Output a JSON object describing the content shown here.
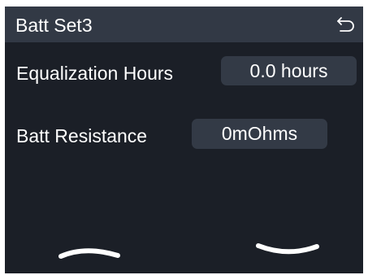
{
  "title_bar": {
    "title": "Batt Set3",
    "back_icon": "return-arrow-icon"
  },
  "settings": [
    {
      "label": "Equalization Hours",
      "value": "0.0 hours"
    },
    {
      "label": "Batt Resistance",
      "value": "0mOhms"
    }
  ],
  "navigation": {
    "up_icon": "chevron-up-icon",
    "down_icon": "chevron-down-icon"
  },
  "colors": {
    "screen_background": "#1b1f27",
    "title_bar_background": "#323945",
    "value_box_background": "#333a46",
    "text": "#ffffff"
  }
}
